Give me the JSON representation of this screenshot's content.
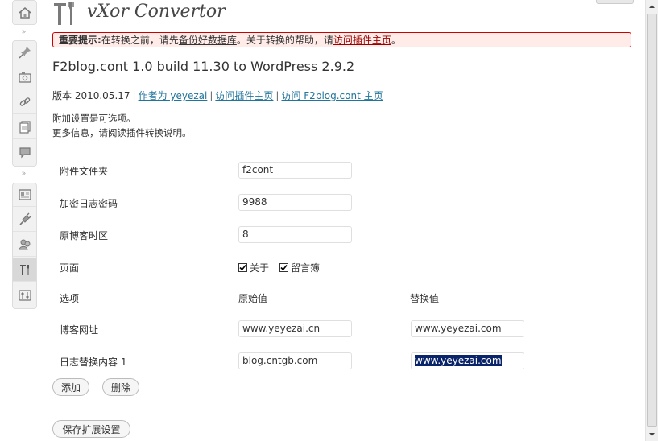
{
  "header": {
    "title": "vXor Convertor"
  },
  "notice": {
    "label": "重要提示:",
    "text_before": "在转换之前，请先",
    "backup": "备份好数据库",
    "text_mid": "。关于转换的帮助，请",
    "link": "访问插件主页",
    "text_end": "。"
  },
  "page": {
    "title": "F2blog.cont 1.0 build 11.30 to WordPress 2.9.2",
    "version": "版本 2010.05.17",
    "sep": "|",
    "author_link": "作者为 yeyezai",
    "plugin_link": "访问插件主页",
    "f2_link": "访问 F2blog.cont 主页",
    "desc1": "附加设置是可选项。",
    "desc2": "更多信息，请阅读插件转换说明。"
  },
  "form": {
    "attach_folder": {
      "label": "附件文件夹",
      "value": "f2cont"
    },
    "encrypt_pwd": {
      "label": "加密日志密码",
      "value": "9988"
    },
    "timezone": {
      "label": "原博客时区",
      "value": "8"
    },
    "pages": {
      "label": "页面",
      "opt1": "关于",
      "opt2": "留言簿",
      "opt1_checked": true,
      "opt2_checked": true
    },
    "options_header": {
      "label": "选项",
      "original": "原始值",
      "replace": "替换值"
    },
    "blog_url": {
      "label": "博客网址",
      "original": "www.yeyezai.cn",
      "replace": "www.yeyezai.com"
    },
    "replace1": {
      "label": "日志替换内容 1",
      "original": "blog.cntgb.com",
      "replace": "www.yeyezai.com"
    }
  },
  "buttons": {
    "add": "添加",
    "delete": "删除",
    "save": "保存扩展设置"
  },
  "sidebar_icons": [
    "dashboard-icon",
    "posts-icon",
    "media-icon",
    "links-icon",
    "pages-icon",
    "comments-icon",
    "appearance-icon",
    "plugins-icon",
    "users-icon",
    "tools-icon",
    "settings-icon"
  ],
  "colors": {
    "notice_bg": "#ffebe8",
    "notice_border": "#cc0000",
    "link": "#21759b",
    "selection": "#0a246a"
  }
}
